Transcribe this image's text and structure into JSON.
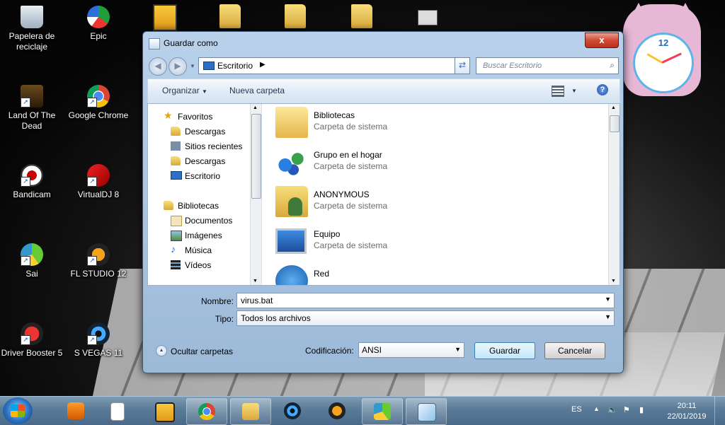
{
  "desktop": {
    "icons": [
      {
        "label": "Papelera de reciclaje"
      },
      {
        "label": "Epic"
      },
      {
        "label": "Land Of The Dead"
      },
      {
        "label": "Google Chrome"
      },
      {
        "label": "Bandicam"
      },
      {
        "label": "VirtualDJ 8"
      },
      {
        "label": "Sai"
      },
      {
        "label": "FL STUDIO 12"
      },
      {
        "label": "Driver Booster 5"
      },
      {
        "label": "S VEGAS 11"
      }
    ],
    "clock_number": "12"
  },
  "dialog": {
    "title": "Guardar como",
    "close_glyph": "x",
    "address": "Escritorio",
    "search_placeholder": "Buscar Escritorio",
    "toolbar": {
      "organize": "Organizar",
      "new_folder": "Nueva carpeta",
      "help": "?"
    },
    "nav": {
      "favorites": "Favoritos",
      "fav_items": [
        "Descargas",
        "Sitios recientes",
        "Descargas",
        "Escritorio"
      ],
      "libraries": "Bibliotecas",
      "lib_items": [
        "Documentos",
        "Imágenes",
        "Música",
        "Vídeos"
      ]
    },
    "files": [
      {
        "name": "Bibliotecas",
        "type": "Carpeta de sistema"
      },
      {
        "name": "Grupo en el hogar",
        "type": "Carpeta de sistema"
      },
      {
        "name": "ANONYMOUS",
        "type": "Carpeta de sistema"
      },
      {
        "name": "Equipo",
        "type": "Carpeta de sistema"
      },
      {
        "name": "Red",
        "type": ""
      }
    ],
    "form": {
      "name_label": "Nombre:",
      "name_value": "virus.bat",
      "type_label": "Tipo:",
      "type_value": "Todos los archivos"
    },
    "bottom": {
      "hide_folders": "Ocultar carpetas",
      "encoding_label": "Codificación:",
      "encoding_value": "ANSI",
      "save": "Guardar",
      "cancel": "Cancelar"
    }
  },
  "taskbar": {
    "language": "ES",
    "time": "20:11",
    "date": "22/01/2019"
  }
}
